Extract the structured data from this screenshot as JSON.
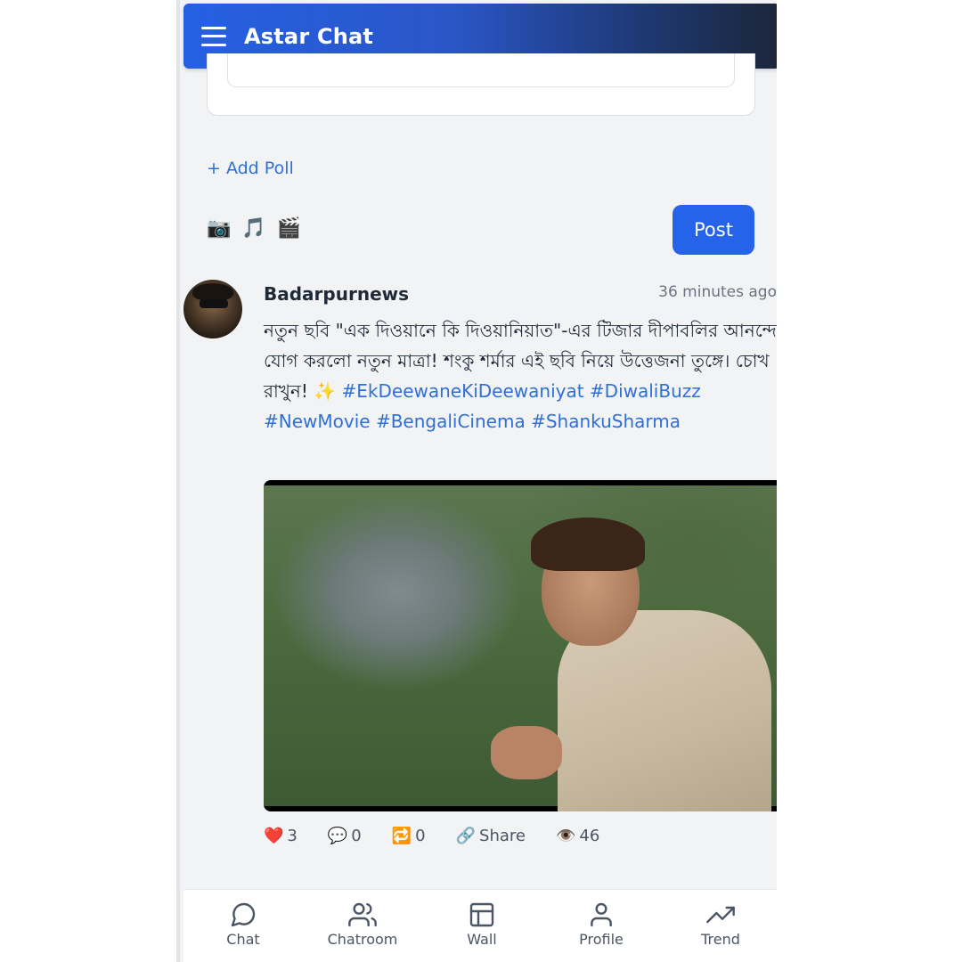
{
  "app": {
    "title": "Astar Chat"
  },
  "composer": {
    "add_poll_label": "+ Add Poll",
    "media_icons": [
      {
        "name": "camera-icon",
        "glyph": "📷"
      },
      {
        "name": "music-icon",
        "glyph": "🎵"
      },
      {
        "name": "video-icon",
        "glyph": "🎬"
      }
    ],
    "post_label": "Post"
  },
  "post": {
    "username": "Badarpurnews",
    "timestamp": "36 minutes ago",
    "text": "নতুন ছবি \"এক দিওয়ানে কি দিওয়ানিয়াত\"-এর টিজার দীপাবলির আনন্দে যোগ করলো নতুন মাত্রা! শংকু শর্মার এই ছবি নিয়ে উত্তেজনা তুঙ্গে। চোখ রাখুন! ✨",
    "hashtags": [
      "#EkDeewaneKiDeewaniyat",
      "#DiwaliBuzz",
      "#NewMovie",
      "#BengaliCinema",
      "#ShankuSharma"
    ],
    "stats": {
      "likes": {
        "icon": "❤️",
        "value": "3"
      },
      "comments": {
        "icon": "💬",
        "value": "0"
      },
      "reposts": {
        "icon": "🔁",
        "value": "0"
      },
      "share": {
        "icon": "🔗",
        "label": "Share"
      },
      "views": {
        "icon": "👁️",
        "value": "46"
      }
    }
  },
  "nav": {
    "items": [
      {
        "key": "chat",
        "label": "Chat",
        "icon": "chat-bubble-icon"
      },
      {
        "key": "chatroom",
        "label": "Chatroom",
        "icon": "users-icon"
      },
      {
        "key": "wall",
        "label": "Wall",
        "icon": "layout-icon"
      },
      {
        "key": "profile",
        "label": "Profile",
        "icon": "user-icon"
      },
      {
        "key": "trend",
        "label": "Trend",
        "icon": "trending-up-icon"
      }
    ]
  },
  "colors": {
    "accent": "#2563eb",
    "link": "#2f6fd6",
    "header_start": "#2560e2",
    "header_end": "#1b2639"
  }
}
